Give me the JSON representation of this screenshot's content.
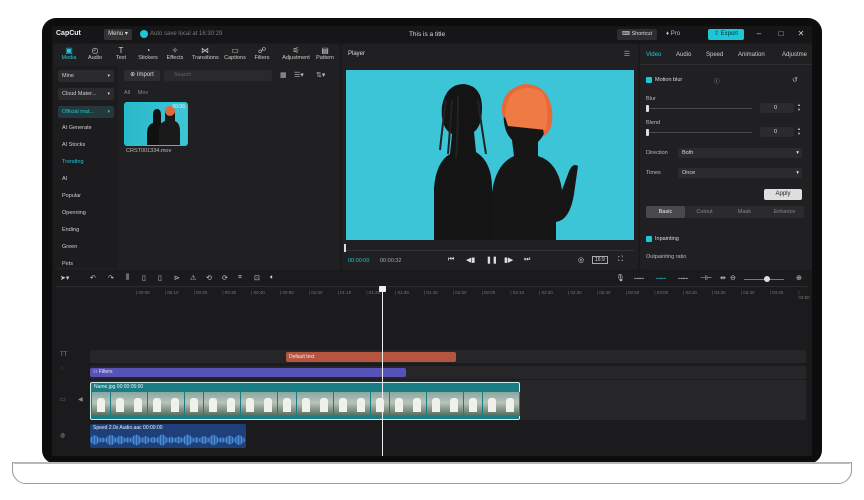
{
  "app": {
    "logo": "CapCut",
    "menu_label": "Menu",
    "autosave": "Auto save local at 16:30:29",
    "title": "This is a title",
    "shortcut": "Shortcut",
    "pro": "Pro",
    "export": "Export"
  },
  "media": {
    "tabs": [
      {
        "label": "Media",
        "icon": "media-icon"
      },
      {
        "label": "Audio",
        "icon": "audio-icon"
      },
      {
        "label": "Text",
        "icon": "text-icon"
      },
      {
        "label": "Stickers",
        "icon": "stickers-icon"
      },
      {
        "label": "Effects",
        "icon": "effects-icon"
      },
      {
        "label": "Transitions",
        "icon": "transitions-icon"
      },
      {
        "label": "Captions",
        "icon": "captions-icon"
      },
      {
        "label": "Filters",
        "icon": "filters-icon"
      },
      {
        "label": "Adjustment",
        "icon": "adjustment-icon"
      },
      {
        "label": "Pattern",
        "icon": "pattern-icon"
      }
    ],
    "sidebar": [
      "Mine",
      "Cloud Mater...",
      "Official mat...",
      "AI Generate",
      "AI Stocks",
      "Trending",
      "AI",
      "Popular",
      "Openning",
      "Ending",
      "Green",
      "Pets"
    ],
    "import": "Import",
    "search_placeholder": "Search",
    "filters": [
      "All",
      "Mov"
    ],
    "clip_name": "CRST001334.mov",
    "clip_duration": "00:06"
  },
  "player": {
    "title": "Player",
    "time_current": "00:00:00",
    "time_total": "00:00:32",
    "ratio": "16:9"
  },
  "properties": {
    "tabs": [
      "Video",
      "Audio",
      "Speed",
      "Animation",
      "Adjustme"
    ],
    "motion_blur": "Motion blur",
    "blur_label": "Blur",
    "blur_value": "0",
    "blend_label": "Blend",
    "blend_value": "0",
    "direction_label": "Direction",
    "direction_value": "Both",
    "times_label": "Times",
    "times_value": "Once",
    "apply": "Apply",
    "segments": [
      "Basic",
      "Cutout",
      "Mask",
      "Enhance"
    ],
    "inpainting": "Inpainting",
    "outpainting": "Outpainting ratio"
  },
  "timeline": {
    "ruler": [
      "00:00",
      "00:10",
      "00:20",
      "00:30",
      "00:40",
      "00:50",
      "01:00",
      "01:10",
      "01:20",
      "01:30",
      "01:40",
      "01:50",
      "02:00",
      "02:10",
      "02:20",
      "02:30",
      "02:40",
      "02:50",
      "03:00",
      "03:10",
      "03:20",
      "03:30",
      "03:40",
      "03:50"
    ],
    "text_clip": "Default text",
    "filter_clip": "Filters",
    "video_clip": "Name.jpg  00:00:05:00",
    "audio_clip": "Speed 2.0x  Audio.aac  00:00:00"
  }
}
